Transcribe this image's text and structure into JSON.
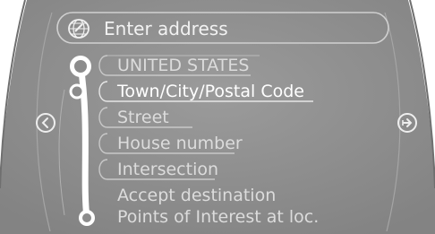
{
  "header": {
    "title": "Enter address",
    "icon": "globe-icon"
  },
  "menu": {
    "items": [
      {
        "label": "UNITED STATES",
        "selected": false
      },
      {
        "label": "Town/City/Postal Code",
        "selected": true
      },
      {
        "label": "Street",
        "selected": false
      },
      {
        "label": "House number",
        "selected": false
      },
      {
        "label": "Intersection",
        "selected": false
      },
      {
        "label": "Accept destination",
        "selected": false
      },
      {
        "label": "Points of Interest at loc.",
        "selected": false
      }
    ]
  },
  "nav": {
    "left_icon": "chevron-left-icon",
    "right_icon": "chevron-right-icon"
  },
  "colors": {
    "panel": "#8c8c8c",
    "text": "#f2f2f2",
    "frame": "#ffffff"
  }
}
